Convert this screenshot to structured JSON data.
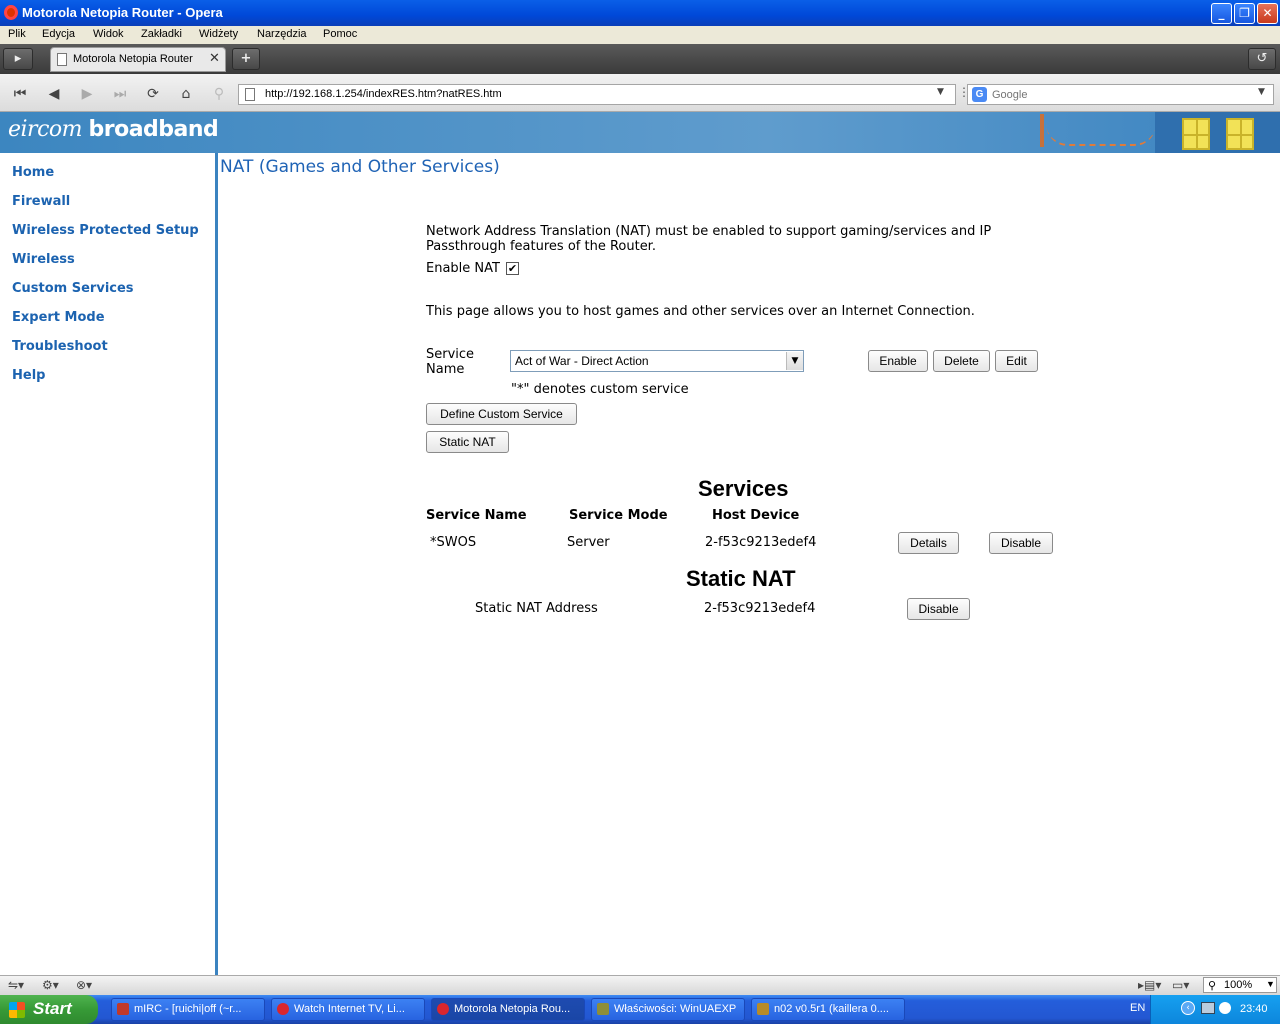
{
  "window": {
    "title": "Motorola Netopia Router - Opera"
  },
  "menu": [
    "Plik",
    "Edycja",
    "Widok",
    "Zakładki",
    "Widżety",
    "Narzędzia",
    "Pomoc"
  ],
  "tab": {
    "title": "Motorola Netopia Router"
  },
  "address": {
    "url": "http://192.168.1.254/indexRES.htm?natRES.htm"
  },
  "search": {
    "placeholder": "Google"
  },
  "brand": {
    "part1": "eircom",
    "part2": "broadband"
  },
  "sidebar": {
    "items": [
      {
        "label": "Home"
      },
      {
        "label": "Firewall"
      },
      {
        "label": "Wireless Protected Setup"
      },
      {
        "label": "Wireless"
      },
      {
        "label": "Custom Services"
      },
      {
        "label": "Expert Mode"
      },
      {
        "label": "Troubleshoot"
      },
      {
        "label": "Help"
      }
    ]
  },
  "page": {
    "title": "NAT (Games and Other Services)",
    "nat_info_line1": "Network Address Translation (NAT) must be enabled to support gaming/services and IP",
    "nat_info_line2": "Passthrough features of the Router.",
    "enable_nat_label": "Enable NAT",
    "enable_nat_checked": true,
    "host_info": "This page allows you to host games and other services over an Internet Connection.",
    "service_name_label_1": "Service",
    "service_name_label_2": "Name",
    "service_selected": "Act of War - Direct Action",
    "custom_note": "\"*\" denotes custom service",
    "buttons": {
      "enable": "Enable",
      "delete": "Delete",
      "edit": "Edit",
      "define_custom": "Define Custom Service",
      "static_nat": "Static NAT"
    },
    "services": {
      "heading": "Services",
      "columns": [
        "Service Name",
        "Service Mode",
        "Host Device"
      ],
      "rows": [
        {
          "name": "*SWOS",
          "mode": "Server",
          "host": "2-f53c9213edef4",
          "details": "Details",
          "disable": "Disable"
        }
      ]
    },
    "static_nat": {
      "heading": "Static NAT",
      "label": "Static NAT Address",
      "host": "2-f53c9213edef4",
      "disable": "Disable"
    }
  },
  "statusbar": {
    "zoom": "100%"
  },
  "taskbar": {
    "start": "Start",
    "tasks": [
      {
        "label": "mIRC - [ruichi|off (~r...",
        "color": "#c0392b"
      },
      {
        "label": "Watch Internet TV, Li...",
        "color": "#d9262e"
      },
      {
        "label": "Motorola Netopia Rou...",
        "color": "#d9262e",
        "active": true
      },
      {
        "label": "Właściwości: WinUAEXP",
        "color": "#8e8e3a"
      },
      {
        "label": "n02 v0.5r1 (kaillera 0....",
        "color": "#b78b2a"
      }
    ],
    "lang": "EN",
    "time": "23:40"
  }
}
